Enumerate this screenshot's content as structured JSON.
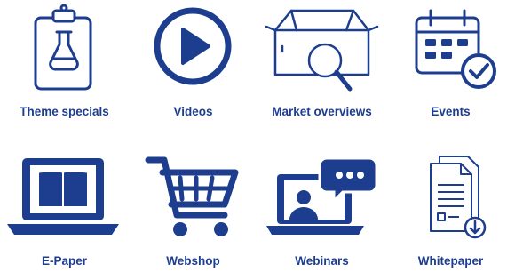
{
  "accent_color": "#1d3e8f",
  "tiles": [
    {
      "label": "Theme specials",
      "icon": "clipboard-flask-icon"
    },
    {
      "label": "Videos",
      "icon": "play-circle-icon"
    },
    {
      "label": "Market overviews",
      "icon": "box-magnifier-icon"
    },
    {
      "label": "Events",
      "icon": "calendar-check-icon"
    },
    {
      "label": "E-Paper",
      "icon": "laptop-book-icon"
    },
    {
      "label": "Webshop",
      "icon": "shopping-cart-icon"
    },
    {
      "label": "Webinars",
      "icon": "laptop-presenter-chat-icon"
    },
    {
      "label": "Whitepaper",
      "icon": "document-download-icon"
    }
  ]
}
